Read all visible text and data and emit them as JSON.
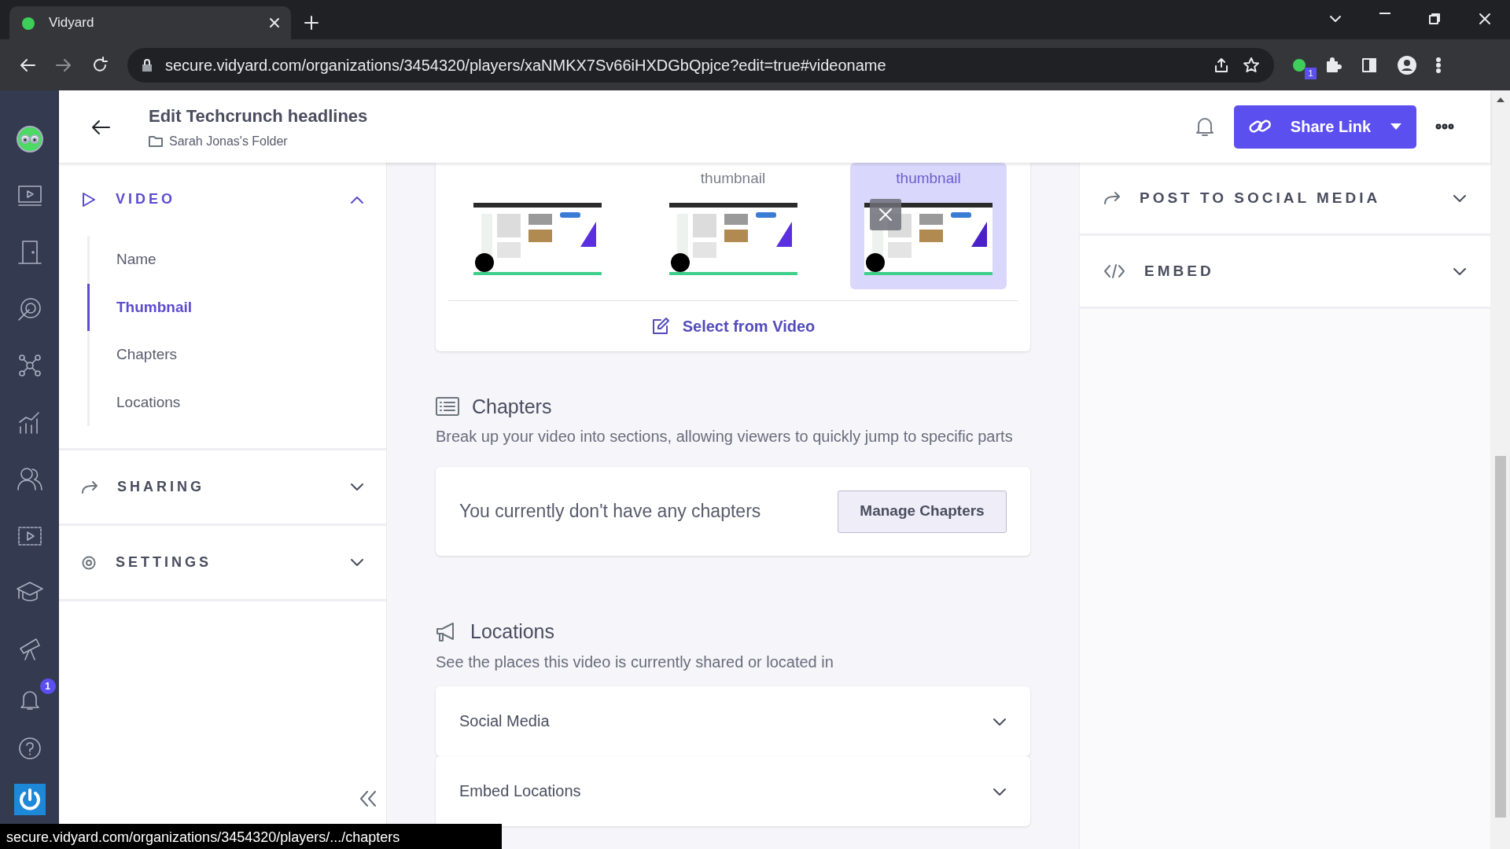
{
  "browser": {
    "tab_title": "Vidyard",
    "url_host": "secure.vidyard.com",
    "url_path": "/organizations/3454320/players/xaNMKX7Sv66iHXDGbQpjce?edit=true#videoname",
    "extension_badge": "1"
  },
  "rail": {
    "notification_badge": "1"
  },
  "header": {
    "title": "Edit Techcrunch headlines",
    "folder": "Sarah Jonas's Folder",
    "share_button": "Share Link"
  },
  "sidebar": {
    "sections": [
      {
        "title": "VIDEO",
        "expanded": true,
        "items": [
          {
            "label": "Name",
            "selected": false
          },
          {
            "label": "Thumbnail",
            "selected": true
          },
          {
            "label": "Chapters",
            "selected": false
          },
          {
            "label": "Locations",
            "selected": false
          }
        ]
      },
      {
        "title": "SHARING",
        "expanded": false
      },
      {
        "title": "SETTINGS",
        "expanded": false
      }
    ]
  },
  "thumbnails": {
    "items": [
      {
        "selected": false
      },
      {
        "label": "thumbnail",
        "selected": false
      },
      {
        "label": "thumbnail",
        "selected": true
      }
    ],
    "select_button": "Select from Video"
  },
  "chapters": {
    "title": "Chapters",
    "description": "Break up your video into sections, allowing viewers to quickly jump to specific parts",
    "empty_text": "You currently don't have any chapters",
    "button": "Manage Chapters"
  },
  "locations": {
    "title": "Locations",
    "description": "See the places this video is currently shared or located in",
    "items": [
      {
        "label": "Social Media",
        "expanded": false
      },
      {
        "label": "Embed Locations",
        "expanded": false
      }
    ]
  },
  "right_panel": {
    "sections": [
      {
        "title": "POST TO SOCIAL MEDIA",
        "expanded": false
      },
      {
        "title": "EMBED",
        "expanded": false
      }
    ]
  },
  "status_url": "secure.vidyard.com/organizations/3454320/players/.../chapters"
}
